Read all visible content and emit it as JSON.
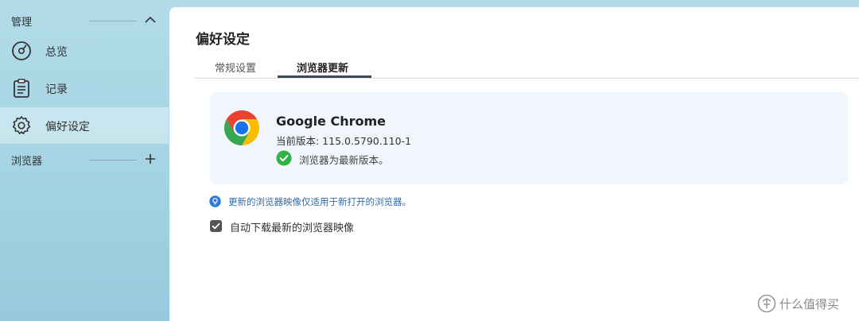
{
  "sidebar": {
    "manage_section": {
      "title": "管理"
    },
    "items": [
      {
        "label": "总览",
        "icon": "dashboard-gauge-icon"
      },
      {
        "label": "记录",
        "icon": "clipboard-log-icon"
      },
      {
        "label": "偏好设定",
        "icon": "gear-icon",
        "active": true
      }
    ],
    "browser_section": {
      "title": "浏览器"
    }
  },
  "main": {
    "title": "偏好设定",
    "tabs": [
      {
        "label": "常规设置",
        "active": false
      },
      {
        "label": "浏览器更新",
        "active": true
      }
    ],
    "browser_card": {
      "name": "Google Chrome",
      "version_label": "当前版本: 115.0.5790.110-1",
      "status": "浏览器为最新版本。",
      "status_color": "#2fb344"
    },
    "hint": "更新的浏览器映像仅适用于新打开的浏览器。",
    "auto_download": {
      "label": "自动下载最新的浏览器映像",
      "checked": true
    }
  },
  "watermark": {
    "text": "什么值得买"
  },
  "colors": {
    "accent": "#2b6cb0",
    "tab_underline": "#3a4a5a"
  }
}
